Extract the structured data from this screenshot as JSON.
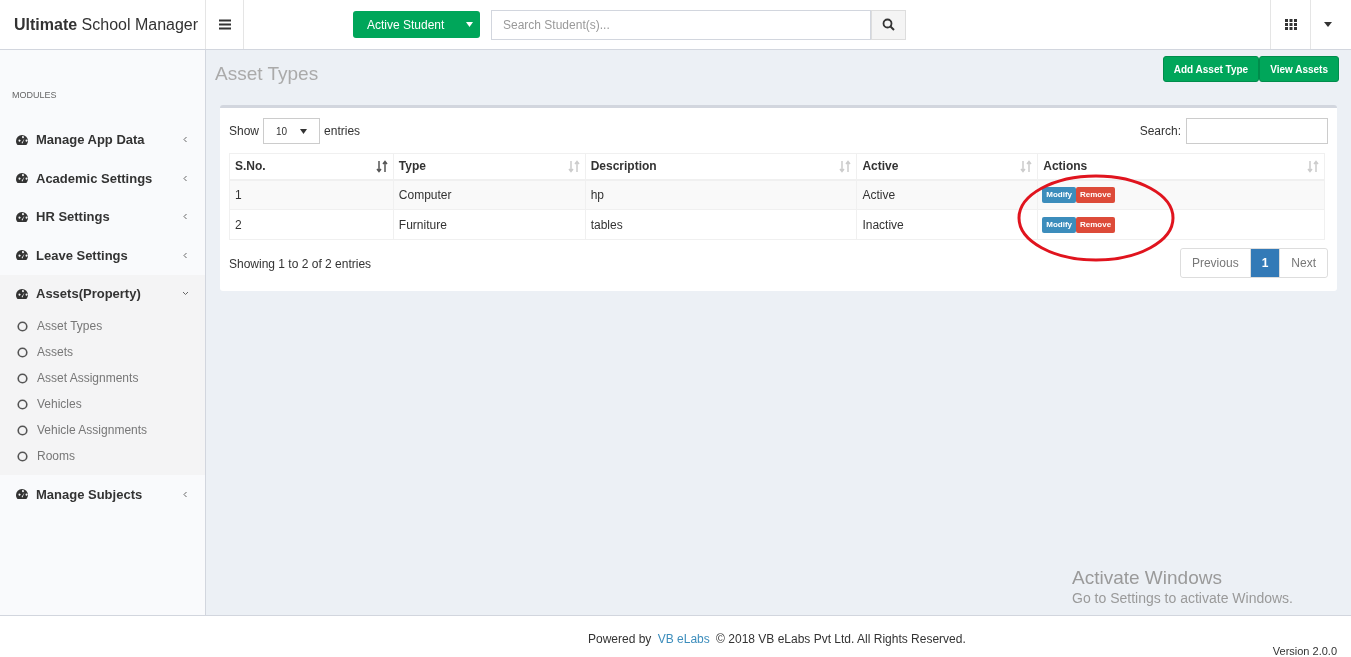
{
  "header": {
    "brand_bold": "Ultimate",
    "brand_rest": "School Manager",
    "student_button": "Active Student",
    "search": {
      "placeholder": "Search Student(s)..."
    }
  },
  "sidebar": {
    "heading": "MODULES",
    "items": [
      {
        "label": "Manage App Data",
        "expanded": false
      },
      {
        "label": "Academic Settings",
        "expanded": false
      },
      {
        "label": "HR Settings",
        "expanded": false
      },
      {
        "label": "Leave Settings",
        "expanded": false
      },
      {
        "label": "Assets(Property)",
        "expanded": true,
        "children": [
          {
            "label": "Asset Types"
          },
          {
            "label": "Assets"
          },
          {
            "label": "Asset Assignments"
          },
          {
            "label": "Vehicles"
          },
          {
            "label": "Vehicle Assignments"
          },
          {
            "label": "Rooms"
          }
        ]
      },
      {
        "label": "Manage Subjects",
        "expanded": false
      }
    ]
  },
  "page": {
    "title": "Asset Types",
    "buttons": [
      "Add Asset Type",
      "View Assets"
    ]
  },
  "table": {
    "show_label": "Show",
    "page_size": "10",
    "entries_label": "entries",
    "search_label": "Search:",
    "columns": [
      {
        "label": "S.No.",
        "sorted": true
      },
      {
        "label": "Type",
        "sorted": false
      },
      {
        "label": "Description",
        "sorted": false
      },
      {
        "label": "Active",
        "sorted": false
      },
      {
        "label": "Actions",
        "sorted": false
      }
    ],
    "rows": [
      {
        "cells": [
          "1",
          "Computer",
          "hp",
          "Active"
        ],
        "actions": [
          "Modify",
          "Remove"
        ]
      },
      {
        "cells": [
          "2",
          "Furniture",
          "tables",
          "Inactive"
        ],
        "actions": [
          "Modify",
          "Remove"
        ]
      }
    ],
    "info": "Showing 1 to 2 of 2 entries",
    "pagination": [
      {
        "label": "Previous",
        "kind": "prev",
        "selected": false
      },
      {
        "label": "1",
        "kind": "page",
        "selected": true
      },
      {
        "label": "Next",
        "kind": "next",
        "selected": false
      }
    ]
  },
  "footer": {
    "powered": "Powered by",
    "link": "VB eLabs",
    "copyright": "© 2018 VB eLabs Pvt Ltd. All Rights Reserved.",
    "version": "Version 2.0.0"
  },
  "os_notice": {
    "title": "Activate Windows",
    "text": "Go to Settings to activate Windows."
  }
}
